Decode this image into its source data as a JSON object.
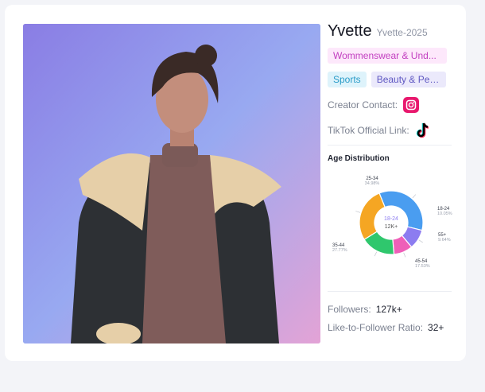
{
  "profile": {
    "name": "Yvette",
    "handle": "Yvette-2025",
    "category_primary": "Wommenswear & Und...",
    "tags": [
      "Sports",
      "Beauty & Per..."
    ],
    "contact_label": "Creator Contact:",
    "contact_icon": "instagram-icon",
    "tiktok_label": "TikTok Official Link:",
    "tiktok_icon": "tiktok-icon"
  },
  "age_distribution": {
    "title": "Age Distribution",
    "center_label": "18-24",
    "center_value": "12K+",
    "segments": [
      {
        "label": "25-34",
        "percent_text": "34.98%",
        "value": 34.98,
        "color": "#4a9df0"
      },
      {
        "label": "18-24",
        "percent_text": "10.05%",
        "value": 10.05,
        "color": "#8c7cf0"
      },
      {
        "label": "55+",
        "percent_text": "9.64%",
        "value": 9.64,
        "color": "#ee5fb8"
      },
      {
        "label": "45-54",
        "percent_text": "17.53%",
        "value": 17.53,
        "color": "#2fc76d"
      },
      {
        "label": "35-44",
        "percent_text": "27.77%",
        "value": 27.77,
        "color": "#f5a623"
      }
    ]
  },
  "stats": {
    "followers_label": "Followers:",
    "followers_value": "127k+",
    "ratio_label": "Like-to-Follower Ratio:",
    "ratio_value": "32+"
  }
}
